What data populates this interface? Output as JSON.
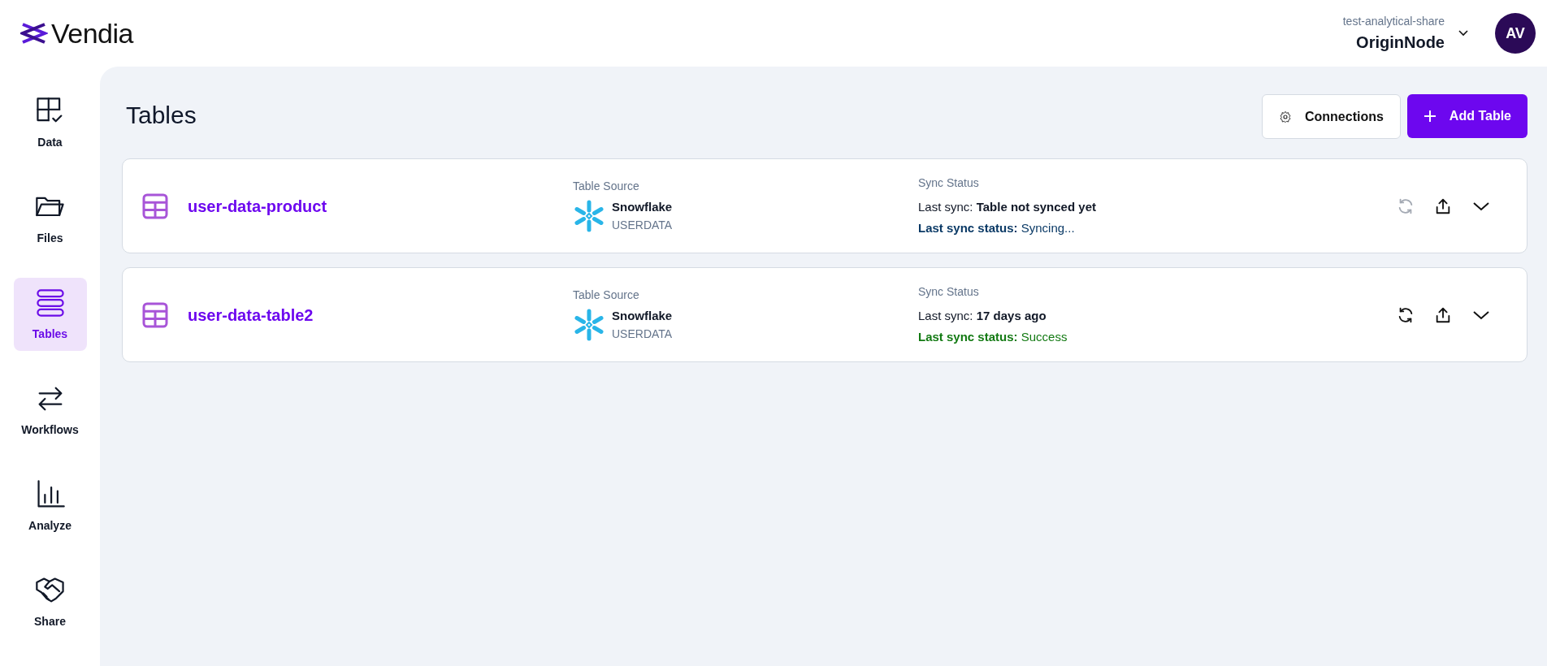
{
  "brand": {
    "name": "Vendia"
  },
  "account": {
    "workspace": "test-analytical-share",
    "node": "OriginNode",
    "avatar": "AV"
  },
  "sidebar": {
    "items": [
      {
        "label": "Data",
        "kind": "data",
        "selected": false
      },
      {
        "label": "Files",
        "kind": "files",
        "selected": false
      },
      {
        "label": "Tables",
        "kind": "tables",
        "selected": true
      },
      {
        "label": "Workflows",
        "kind": "workflows",
        "selected": false
      },
      {
        "label": "Analyze",
        "kind": "analyze",
        "selected": false
      },
      {
        "label": "Share",
        "kind": "share",
        "selected": false
      }
    ]
  },
  "page": {
    "title": "Tables",
    "buttons": [
      {
        "label": "Connections",
        "kind": "secondary"
      },
      {
        "label": "Add Table",
        "kind": "primary"
      }
    ]
  },
  "tables": [
    {
      "name": "user-data-product",
      "source_label": "Table Source",
      "source": "Snowflake",
      "source_db": "USERDATA",
      "sync_label": "Sync Status",
      "last_sync_label": "Last sync:",
      "last_sync": "Table not synced yet",
      "status_label": "Last sync status:",
      "status": "Syncing...",
      "kind": "syncing",
      "sync_disabled": true
    },
    {
      "name": "user-data-table2",
      "source_label": "Table Source",
      "source": "Snowflake",
      "source_db": "USERDATA",
      "sync_label": "Sync Status",
      "last_sync_label": "Last sync:",
      "last_sync": "17 days ago",
      "status_label": "Last sync status:",
      "status": "Success",
      "kind": "success",
      "sync_disabled": false
    }
  ]
}
